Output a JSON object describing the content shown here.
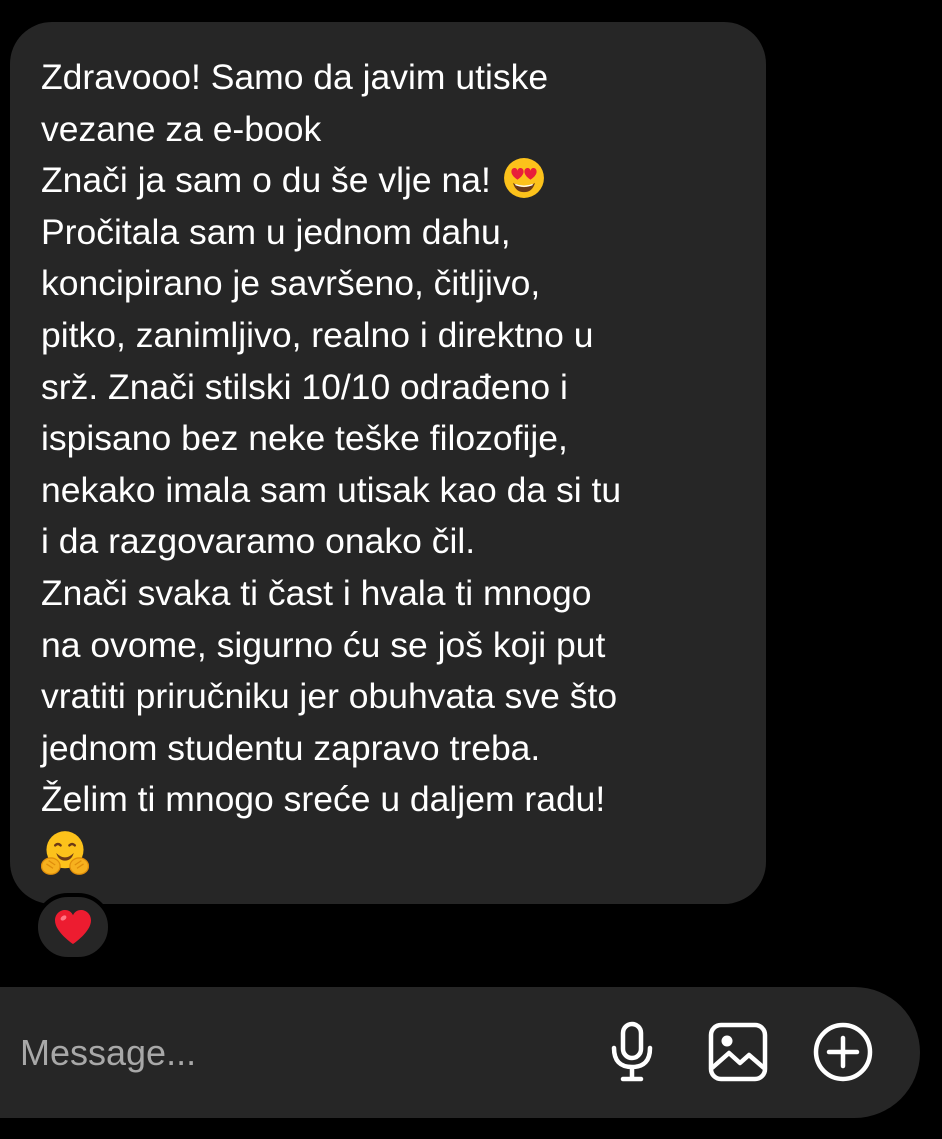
{
  "conversation": {
    "incoming_message": {
      "lines": [
        "Zdravooo! Samo da javim utiske",
        "vezane za e-book",
        "Znači ja sam o du še vlje na!",
        "Pročitala sam u jednom dahu,",
        "koncipirano je savršeno, čitljivo,",
        "pitko, zanimljivo, realno i direktno u",
        "srž. Znači stilski 10/10 odrađeno i",
        "ispisano bez neke teške filozofije,",
        "nekako imala sam utisak kao da si tu",
        "i da razgovaramo onako čil.",
        "Znači svaka ti čast i hvala ti mnogo",
        "na ovome, sigurno ću se još koji put",
        "vratiti priručniku jer obuhvata sve što",
        "jednom studentu zapravo treba.",
        "Želim ti mnogo sreće u daljem radu!"
      ],
      "emojis": [
        "smiling-face-with-heart-eyes",
        "hugging-face"
      ],
      "reaction": "red-heart"
    }
  },
  "composer": {
    "placeholder": "Message...",
    "icons": [
      "microphone-icon",
      "gallery-icon",
      "add-icon"
    ]
  },
  "colors": {
    "background": "#000000",
    "bubble": "#262626",
    "text": "#ffffff",
    "placeholder": "#a8a8a8",
    "heart": "#ed1c30"
  }
}
